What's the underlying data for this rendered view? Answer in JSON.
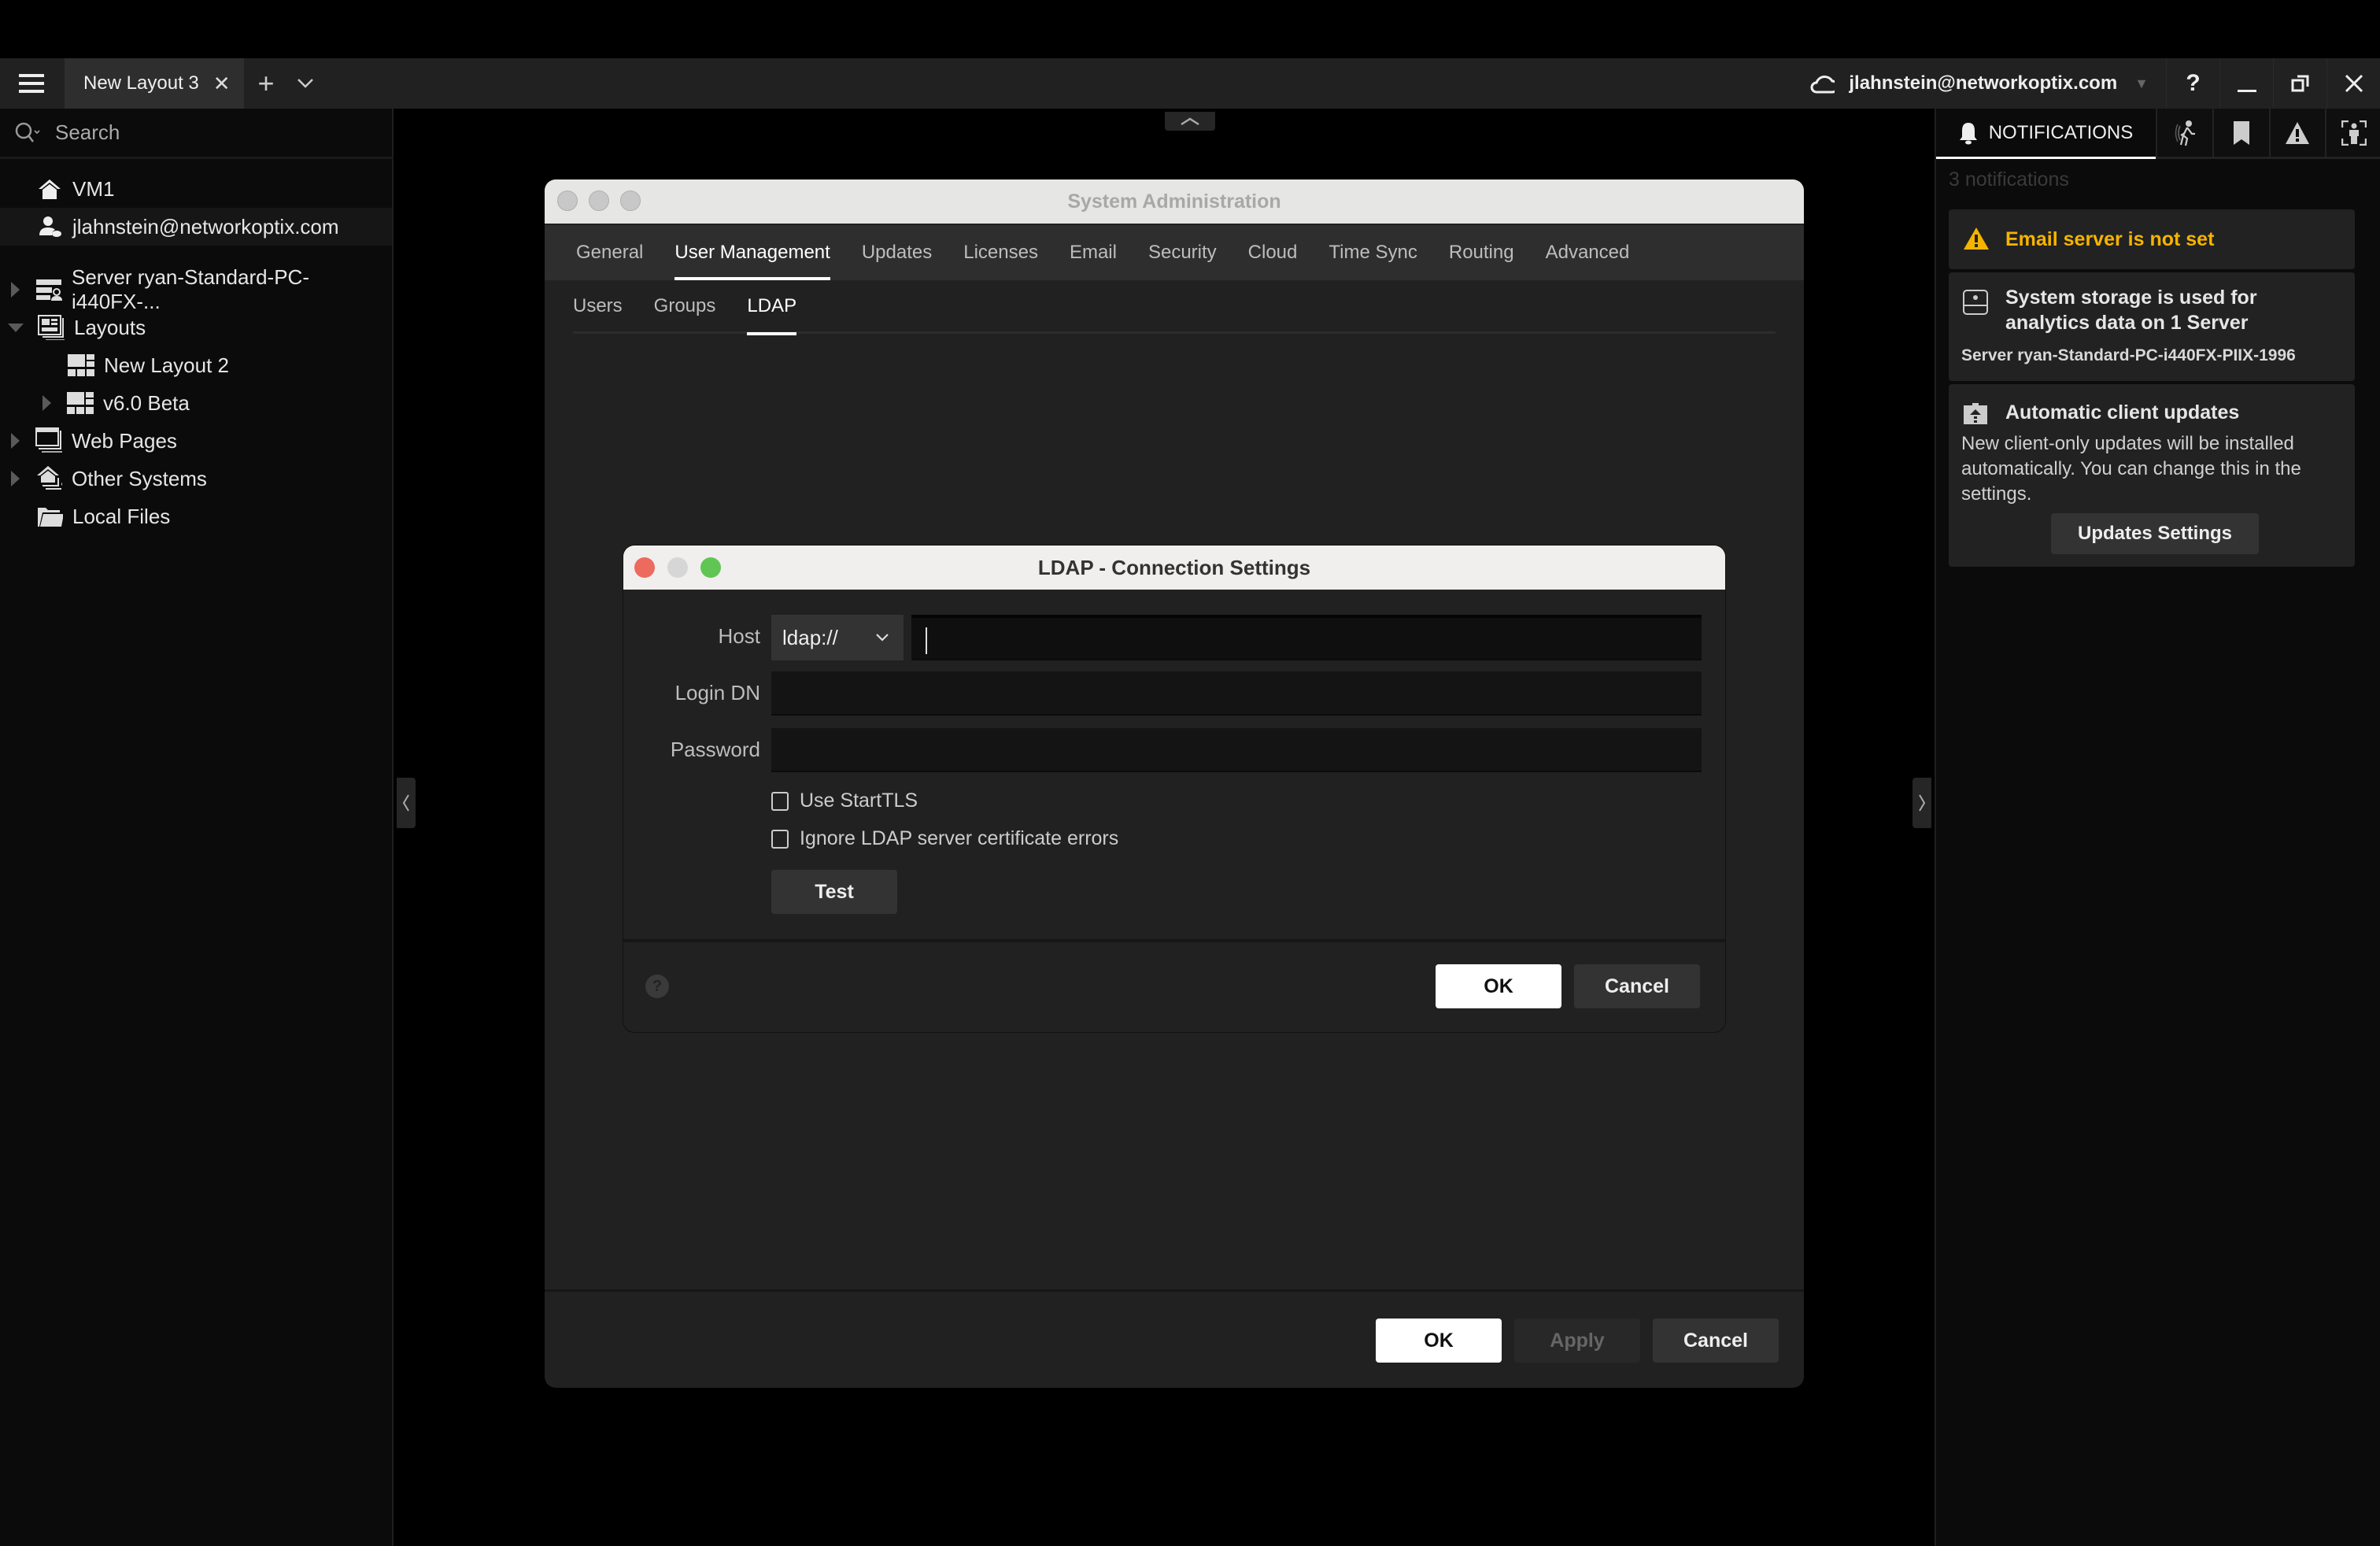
{
  "tabbar": {
    "tab_label": "New Layout 3",
    "close_glyph": "✕",
    "add_glyph": "+",
    "account": "jlahnstein@networkoptix.com",
    "window_buttons": {
      "help": "?",
      "minimize": "_",
      "restore": "restore",
      "close": "✕"
    }
  },
  "left_panel": {
    "search_placeholder": "Search",
    "items": [
      {
        "label": "VM1",
        "icon": "home-icon"
      },
      {
        "label": "jlahnstein@networkoptix.com",
        "icon": "cloud-user-icon"
      },
      {
        "label": "Server ryan-Standard-PC-i440FX-...",
        "icon": "server-icon"
      },
      {
        "label": "Layouts",
        "icon": "layouts-icon"
      },
      {
        "label": "New Layout 2",
        "icon": "layout-icon"
      },
      {
        "label": "v6.0 Beta",
        "icon": "layout-icon"
      },
      {
        "label": "Web Pages",
        "icon": "web-pages-icon"
      },
      {
        "label": "Other Systems",
        "icon": "other-systems-icon"
      },
      {
        "label": "Local Files",
        "icon": "folder-icon"
      }
    ]
  },
  "system_admin": {
    "title": "System Administration",
    "tabs": [
      "General",
      "User Management",
      "Updates",
      "Licenses",
      "Email",
      "Security",
      "Cloud",
      "Time Sync",
      "Routing",
      "Advanced"
    ],
    "active_tab": "User Management",
    "sub_tabs": [
      "Users",
      "Groups",
      "LDAP"
    ],
    "active_sub_tab": "LDAP",
    "buttons": {
      "ok": "OK",
      "apply": "Apply",
      "cancel": "Cancel"
    }
  },
  "ldap_dialog": {
    "title": "LDAP - Connection Settings",
    "host_label": "Host",
    "scheme_value": "ldap://",
    "host_value": "",
    "login_dn_label": "Login DN",
    "login_dn_value": "",
    "password_label": "Password",
    "password_value": "",
    "use_starttls_label": "Use StartTLS",
    "use_starttls_checked": false,
    "ignore_cert_label": "Ignore LDAP server certificate errors",
    "ignore_cert_checked": false,
    "test_label": "Test",
    "ok_label": "OK",
    "cancel_label": "Cancel",
    "help_glyph": "?"
  },
  "notifications": {
    "tab_label": "NOTIFICATIONS",
    "count_text": "3 notifications",
    "warning_color": "#f5b400",
    "items": [
      {
        "title": "Email server is not set",
        "type": "warning"
      },
      {
        "title": "System storage is used for analytics data on 1 Server",
        "sub": "Server ryan-Standard-PC-i440FX-PIIX-1996"
      },
      {
        "title": "Automatic client updates",
        "text": "New client-only updates will be installed automatically. You can change this in the settings.",
        "button": "Updates Settings"
      }
    ]
  }
}
